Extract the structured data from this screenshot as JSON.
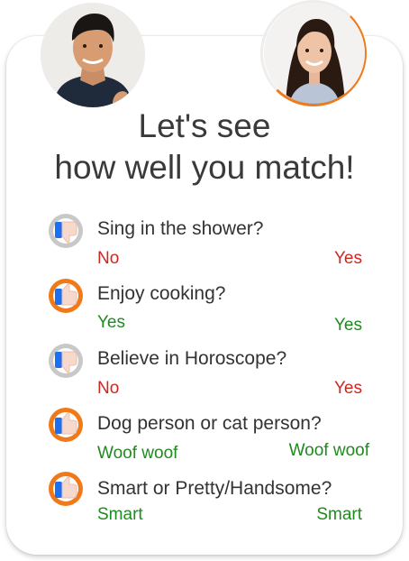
{
  "title": {
    "line1": "Let's see",
    "line2": "how well you match!"
  },
  "colors": {
    "no": "#d0271d",
    "yes": "#1f8a1f",
    "match_badge": "#f07a1a",
    "mismatch_badge": "#c8c8c8",
    "thumb_blue": "#1d6ff2"
  },
  "questions": [
    {
      "text": "Sing in the shower?",
      "left_answer": "No",
      "right_answer": "Yes",
      "match": false,
      "icon": "thumbs-down-icon"
    },
    {
      "text": "Enjoy cooking?",
      "left_answer": "Yes",
      "right_answer": "Yes",
      "match": true,
      "icon": "thumbs-up-icon"
    },
    {
      "text": "Believe in Horoscope?",
      "left_answer": "No",
      "right_answer": "Yes",
      "match": false,
      "icon": "thumbs-down-icon"
    },
    {
      "text": "Dog person or cat person?",
      "left_answer": "Woof woof",
      "right_answer": "Woof woof",
      "match": true,
      "icon": "thumbs-up-icon"
    },
    {
      "text": "Smart or Pretty/Handsome?",
      "left_answer": "Smart",
      "right_answer": "Smart",
      "match": true,
      "icon": "thumbs-up-icon"
    }
  ]
}
